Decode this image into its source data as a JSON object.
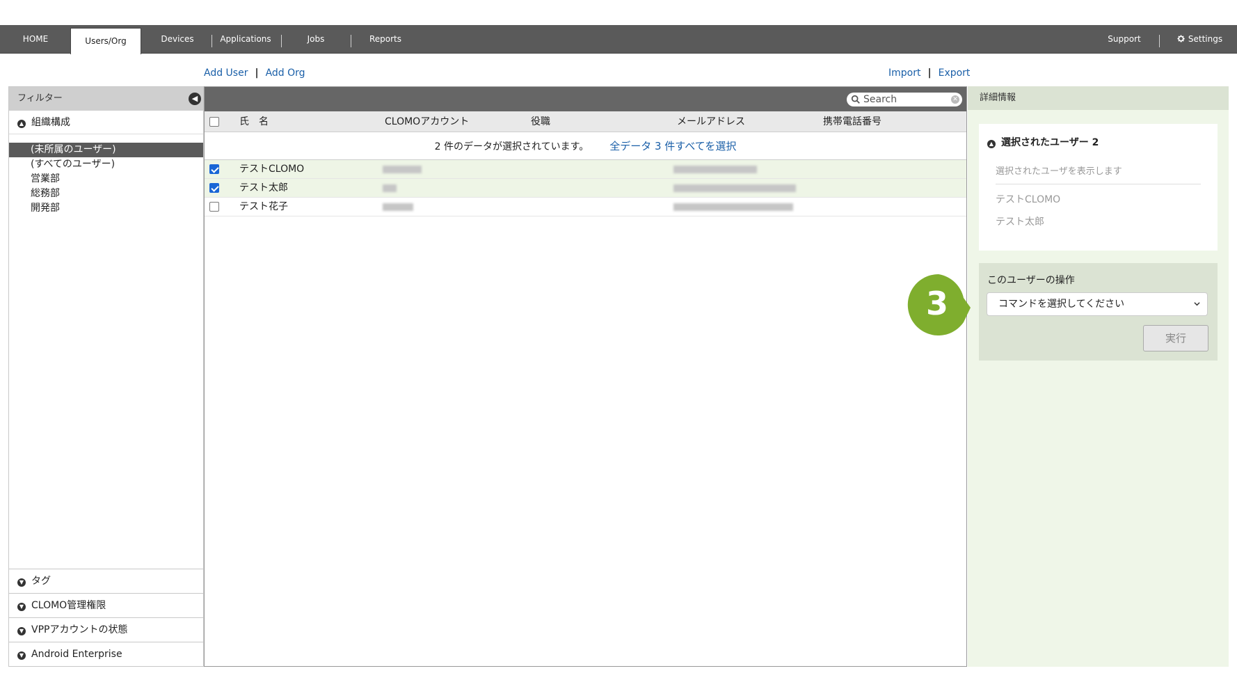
{
  "nav": {
    "tabs": [
      "HOME",
      "Users/Org",
      "Devices",
      "Applications",
      "Jobs",
      "Reports"
    ],
    "support": "Support",
    "settings": "Settings"
  },
  "actions": {
    "add_user": "Add User",
    "add_org": "Add Org",
    "import": "Import",
    "export": "Export"
  },
  "filter": {
    "title": "フィルター",
    "org_section": "組織構成",
    "tree": [
      "(未所属のユーザー)",
      "(すべてのユーザー)",
      "営業部",
      "総務部",
      "開発部"
    ],
    "bottom_sections": [
      "タグ",
      "CLOMO管理権限",
      "VPPアカウントの状態",
      "Android Enterprise"
    ]
  },
  "table": {
    "search_placeholder": "Search",
    "columns": [
      "氏　名",
      "CLOMOアカウント",
      "役職",
      "メールアドレス",
      "携帯電話番号"
    ],
    "selection_message": "2 件のデータが選択されています。",
    "select_all_link": "全データ 3 件すべてを選択",
    "rows": [
      {
        "name": "テストCLOMO",
        "checked": true
      },
      {
        "name": "テスト太郎",
        "checked": true
      },
      {
        "name": "テスト花子",
        "checked": false
      }
    ]
  },
  "details": {
    "title": "詳細情報",
    "selected_users_title": "選択されたユーザー 2",
    "selected_users_hint": "選択されたユーザを表示します",
    "selected_users": [
      "テストCLOMO",
      "テスト太郎"
    ],
    "ops_title": "このユーザーの操作",
    "command_select": "コマンドを選択してください",
    "run_button": "実行"
  },
  "step_badge": "3",
  "colors": {
    "nav_bg": "#5a5a5a",
    "link": "#1a5fa8",
    "badge": "#7fae2e",
    "right_panel": "#eff6e8"
  }
}
